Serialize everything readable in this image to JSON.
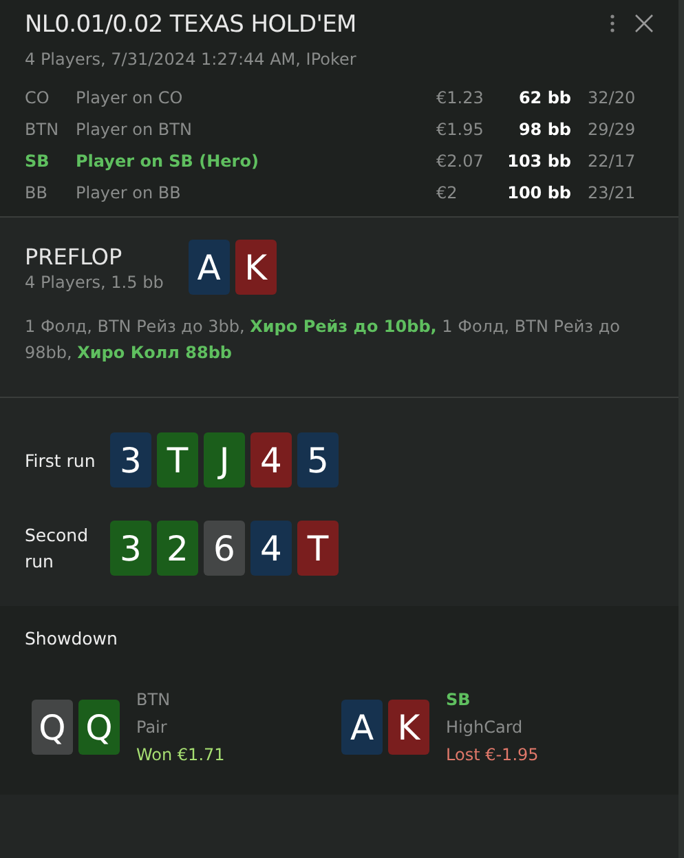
{
  "header": {
    "title": "NL0.01/0.02 TEXAS HOLD'EM",
    "subtitle": "4 Players, 7/31/2024 1:27:44 AM, IPoker"
  },
  "players": [
    {
      "position": "CO",
      "name": "Player on CO",
      "stack": "€1.23",
      "bb": "62 bb",
      "stats": "32/20",
      "hero": false
    },
    {
      "position": "BTN",
      "name": "Player on BTN",
      "stack": "€1.95",
      "bb": "98 bb",
      "stats": "29/29",
      "hero": false
    },
    {
      "position": "SB",
      "name": "Player on SB (Hero)",
      "stack": "€2.07",
      "bb": "103 bb",
      "stats": "22/17",
      "hero": true
    },
    {
      "position": "BB",
      "name": "Player on BB",
      "stack": "€2",
      "bb": "100 bb",
      "stats": "23/21",
      "hero": false
    }
  ],
  "preflop": {
    "title": "PREFLOP",
    "subtitle": "4 Players, 1.5 bb",
    "cards": [
      {
        "rank": "A",
        "color": "#16324f"
      },
      {
        "rank": "K",
        "color": "#7a1e1e"
      }
    ],
    "actions": "1 Фолд, BTN Рейз до 3bb, **Хиро Рейз до 10bb,** 1 Фолд, BTN Рейз до 98bb, **Хиро Колл 88bb**"
  },
  "runs": [
    {
      "label": "First run",
      "cards": [
        {
          "rank": "3",
          "color": "#16324f"
        },
        {
          "rank": "T",
          "color": "#1b5e1b"
        },
        {
          "rank": "J",
          "color": "#1b5e1b"
        },
        {
          "rank": "4",
          "color": "#7a1e1e"
        },
        {
          "rank": "5",
          "color": "#16324f"
        }
      ]
    },
    {
      "label": "Second run",
      "cards": [
        {
          "rank": "3",
          "color": "#1b5e1b"
        },
        {
          "rank": "2",
          "color": "#1b5e1b"
        },
        {
          "rank": "6",
          "color": "#444646"
        },
        {
          "rank": "4",
          "color": "#16324f"
        },
        {
          "rank": "T",
          "color": "#7a1e1e"
        }
      ]
    }
  ],
  "showdown": {
    "title": "Showdown",
    "hands": [
      {
        "position": "BTN",
        "hero": false,
        "hand": "Pair",
        "result": "Won €1.71",
        "won": true,
        "cards": [
          {
            "rank": "Q",
            "color": "#444646"
          },
          {
            "rank": "Q",
            "color": "#1b5e1b"
          }
        ]
      },
      {
        "position": "SB",
        "hero": true,
        "hand": "HighCard",
        "result": "Lost €-1.95",
        "won": false,
        "cards": [
          {
            "rank": "A",
            "color": "#16324f"
          },
          {
            "rank": "K",
            "color": "#7a1e1e"
          }
        ]
      }
    ]
  }
}
